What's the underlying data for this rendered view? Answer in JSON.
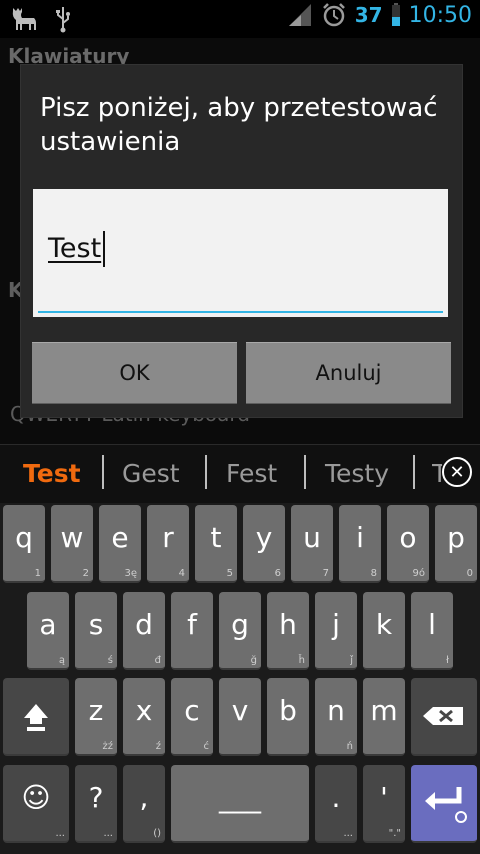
{
  "status_bar": {
    "icons_left": [
      "deer-icon",
      "usb-icon"
    ],
    "icons_right": [
      "signal-icon",
      "alarm-icon",
      "battery-icon"
    ],
    "battery": "37",
    "time": "10:50"
  },
  "background": {
    "title": "Klawiatury",
    "section_letter": "K",
    "item_label": "QWERTY Latin keyboard"
  },
  "dialog": {
    "title": "Pisz poniżej, aby przetestować ustawienia",
    "input_value": "Test",
    "ok_label": "OK",
    "cancel_label": "Anuluj"
  },
  "suggestions": [
    "Test",
    "Gest",
    "Fest",
    "Testy",
    "T"
  ],
  "colors": {
    "accent": "#33b5e5",
    "suggestion_highlight": "#f06a0f",
    "enter_key": "#6a6dbf"
  },
  "keyboard": {
    "row1": [
      {
        "k": "q",
        "s": "1"
      },
      {
        "k": "w",
        "s": "2"
      },
      {
        "k": "e",
        "s": "3ę"
      },
      {
        "k": "r",
        "s": "4"
      },
      {
        "k": "t",
        "s": "5"
      },
      {
        "k": "y",
        "s": "6"
      },
      {
        "k": "u",
        "s": "7"
      },
      {
        "k": "i",
        "s": "8"
      },
      {
        "k": "o",
        "s": "9ó"
      },
      {
        "k": "p",
        "s": "0"
      }
    ],
    "row2": [
      {
        "k": "a",
        "s": "ą"
      },
      {
        "k": "s",
        "s": "ś"
      },
      {
        "k": "d",
        "s": "đ"
      },
      {
        "k": "f",
        "s": ""
      },
      {
        "k": "g",
        "s": "ğ"
      },
      {
        "k": "h",
        "s": "ȟ"
      },
      {
        "k": "j",
        "s": "ǰ"
      },
      {
        "k": "k",
        "s": ""
      },
      {
        "k": "l",
        "s": "ł"
      }
    ],
    "row3": [
      {
        "k": "z",
        "s": "żź"
      },
      {
        "k": "x",
        "s": "ź"
      },
      {
        "k": "c",
        "s": "ć"
      },
      {
        "k": "v",
        "s": ""
      },
      {
        "k": "b",
        "s": ""
      },
      {
        "k": "n",
        "s": "ń"
      },
      {
        "k": "m",
        "s": ""
      }
    ],
    "row4": {
      "emoji": {
        "k": "☺",
        "s": "..."
      },
      "question": {
        "k": "?",
        "s": "..."
      },
      "comma": {
        "k": ",",
        "s": "()"
      },
      "space": {
        "k": "___",
        "s": ""
      },
      "period": {
        "k": ".",
        "s": "..."
      },
      "apostrophe": {
        "k": "'",
        "s": "\".\""
      }
    },
    "icons": {
      "shift": "shift-icon",
      "backspace": "backspace-icon",
      "enter": "enter-icon"
    }
  }
}
